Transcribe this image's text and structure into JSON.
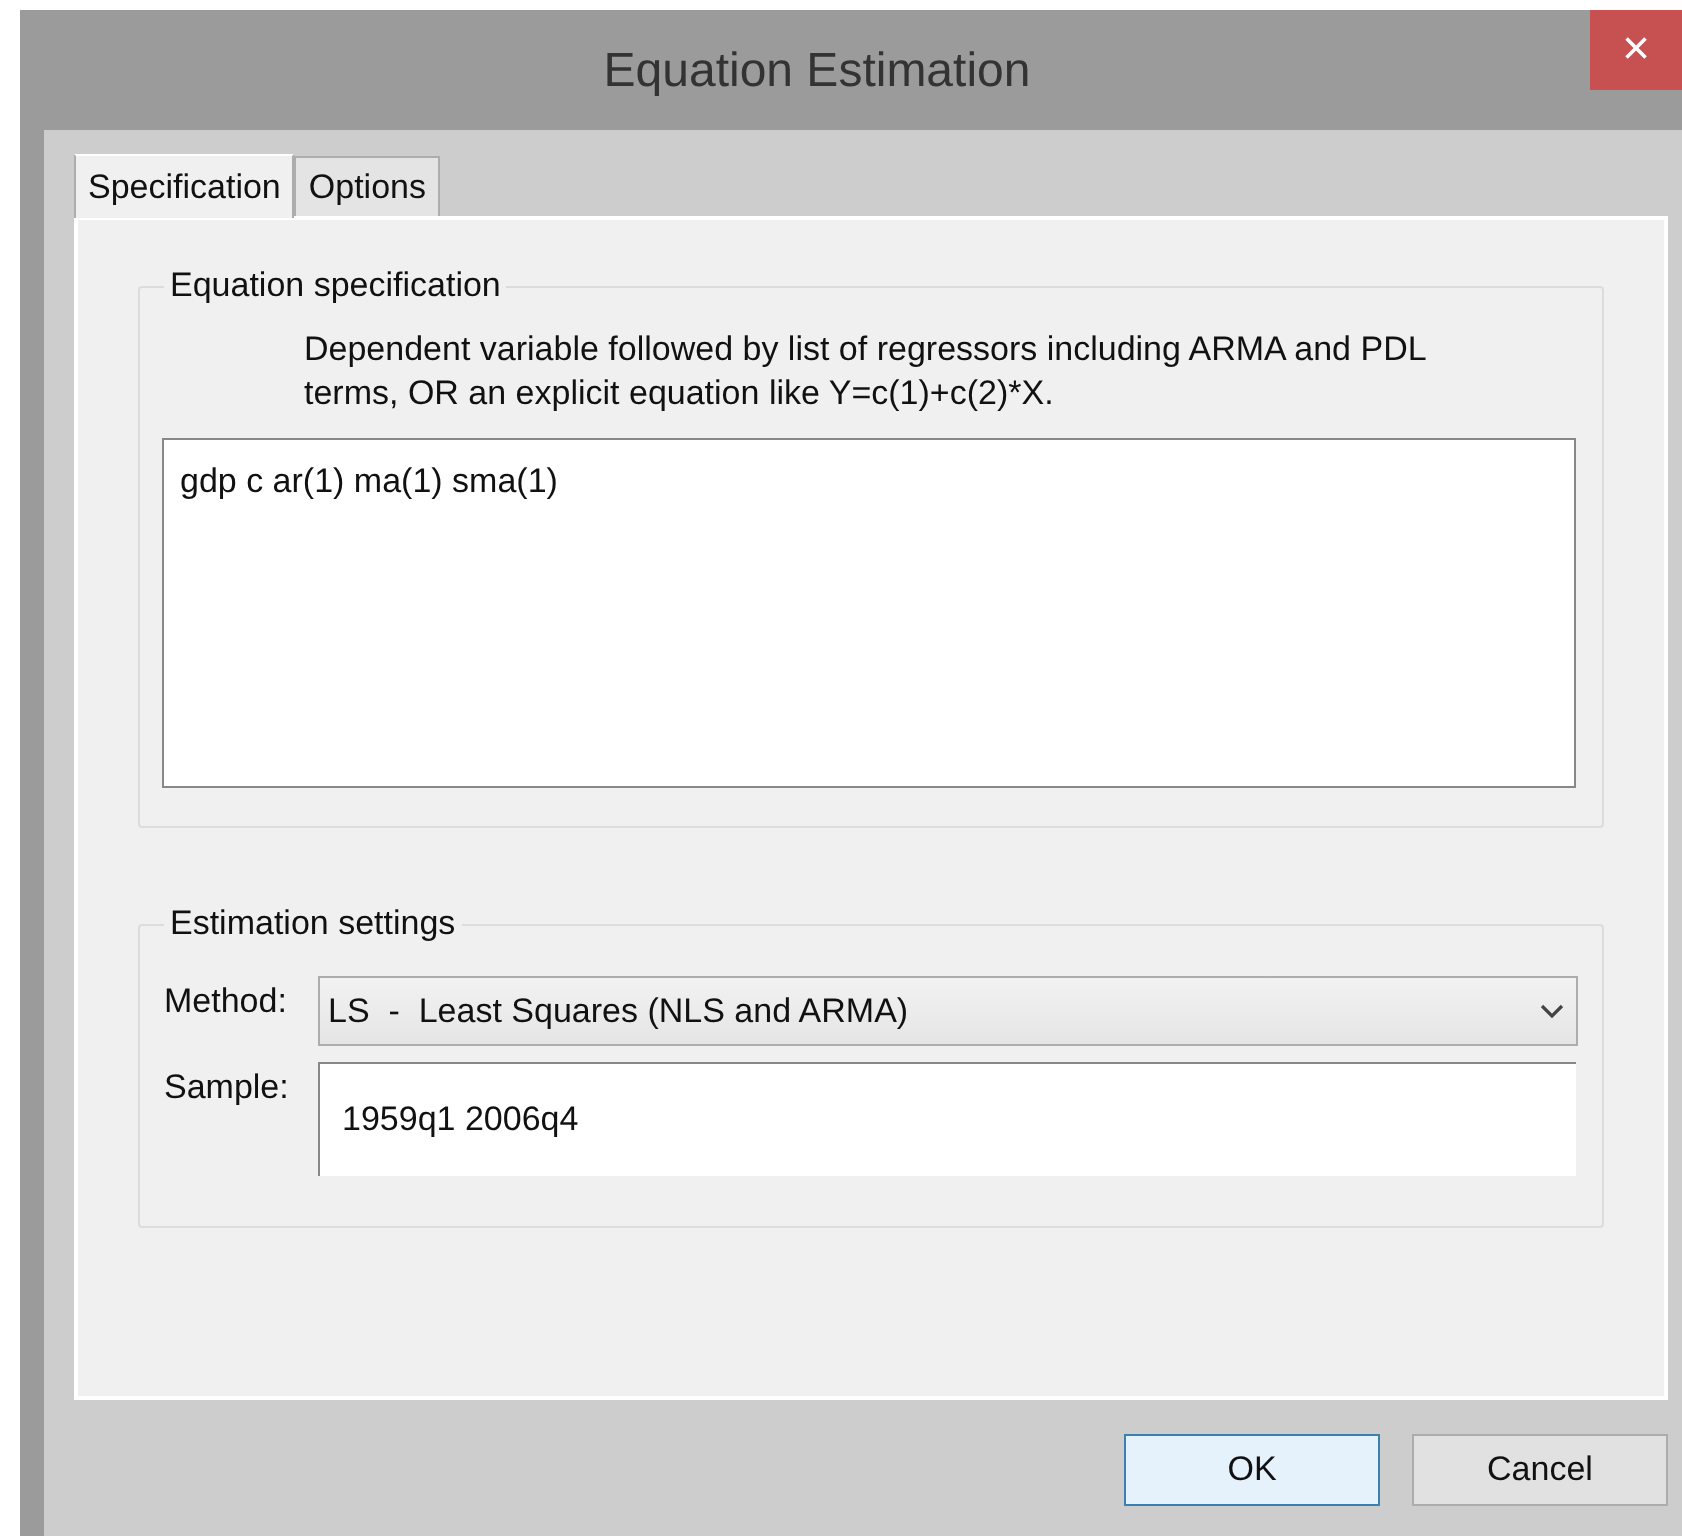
{
  "window": {
    "title": "Equation Estimation",
    "close": "×"
  },
  "tabs": [
    {
      "label": "Specification",
      "selected": true
    },
    {
      "label": "Options",
      "selected": false
    }
  ],
  "equation_specification": {
    "legend": "Equation specification",
    "description": "Dependent variable followed by list of regressors including ARMA and PDL terms, OR an explicit equation like Y=c(1)+c(2)*X.",
    "value": "gdp c ar(1) ma(1) sma(1)"
  },
  "estimation_settings": {
    "legend": "Estimation settings",
    "method_label": "Method:",
    "method": "LS  -  Least Squares (NLS and ARMA)",
    "sample_label": "Sample:",
    "sample": "1959q1 2006q4"
  },
  "buttons": [
    {
      "label": "OK",
      "default": true
    },
    {
      "label": "Cancel",
      "default": false
    }
  ]
}
